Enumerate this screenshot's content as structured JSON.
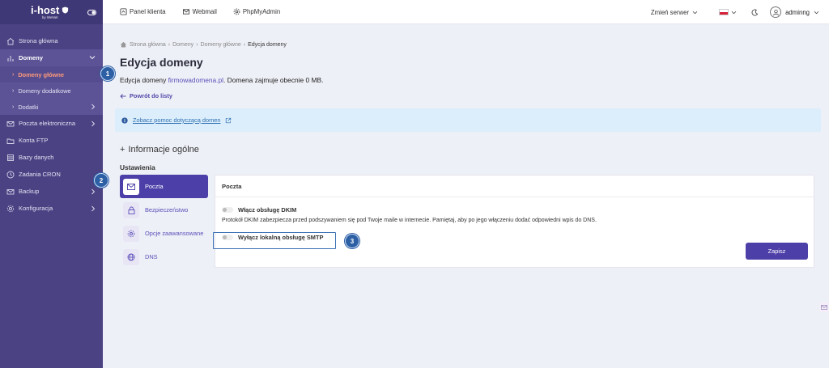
{
  "brand": {
    "name": "i-host",
    "tagline": "by WeNet"
  },
  "topbar": {
    "links": [
      {
        "label": "Panel klienta",
        "icon": "home-icon"
      },
      {
        "label": "Webmail",
        "icon": "mail-icon"
      },
      {
        "label": "PhpMyAdmin",
        "icon": "gear-icon"
      }
    ],
    "server_label": "Zmień serwer",
    "username": "adminng"
  },
  "sidebar": {
    "items": [
      {
        "label": "Strona główna",
        "icon": "home-icon"
      },
      {
        "label": "Domeny",
        "icon": "chart-icon"
      },
      {
        "label": "Poczta elektroniczna",
        "icon": "mail-icon"
      },
      {
        "label": "Konta FTP",
        "icon": "folder-icon"
      },
      {
        "label": "Bazy danych",
        "icon": "database-icon"
      },
      {
        "label": "Zadania CRON",
        "icon": "clock-icon"
      },
      {
        "label": "Backup",
        "icon": "backup-icon"
      },
      {
        "label": "Konfiguracja",
        "icon": "gear-icon"
      }
    ],
    "sub_items": [
      {
        "label": "Domeny główne"
      },
      {
        "label": "Domeny dodatkowe"
      },
      {
        "label": "Dodatki"
      }
    ]
  },
  "breadcrumb": [
    "Strona główna",
    "Domeny",
    "Domeny główne",
    "Edycja domeny"
  ],
  "page": {
    "title": "Edycja domeny",
    "desc_prefix": "Edycja domeny ",
    "domain": "firmowadomena.pl",
    "desc_suffix": ". Domena zajmuje obecnie 0 MB.",
    "back_label": "Powrót do listy",
    "info_link": "Zobacz pomoc dotyczącą domen",
    "section_title": "Informacje ogólne",
    "settings_label": "Ustawienia"
  },
  "tabs": [
    {
      "label": "Poczta",
      "icon": "mail-icon",
      "active": true
    },
    {
      "label": "Bezpieczeństwo",
      "icon": "lock-icon",
      "active": false
    },
    {
      "label": "Opcje zaawansowane",
      "icon": "gear-icon",
      "active": false
    },
    {
      "label": "DNS",
      "icon": "globe-icon",
      "active": false
    }
  ],
  "panel": {
    "title": "Poczta",
    "dkim_label": "Włącz obsługę DKIM",
    "dkim_help": "Protokół DKIM zabezpiecza przed podszywaniem się pod Twoje maile w internecie. Pamiętaj, aby po jego włączeniu dodać odpowiedni wpis do DNS.",
    "smtp_label": "Wyłącz lokalną obsługę SMTP",
    "save_label": "Zapisz"
  },
  "steps": [
    "1",
    "2",
    "3"
  ],
  "colors": {
    "sidebar": "#4a4283",
    "accent": "#4c3fa8",
    "active_link": "#ff9a7a",
    "step": "#2d5fa5"
  }
}
